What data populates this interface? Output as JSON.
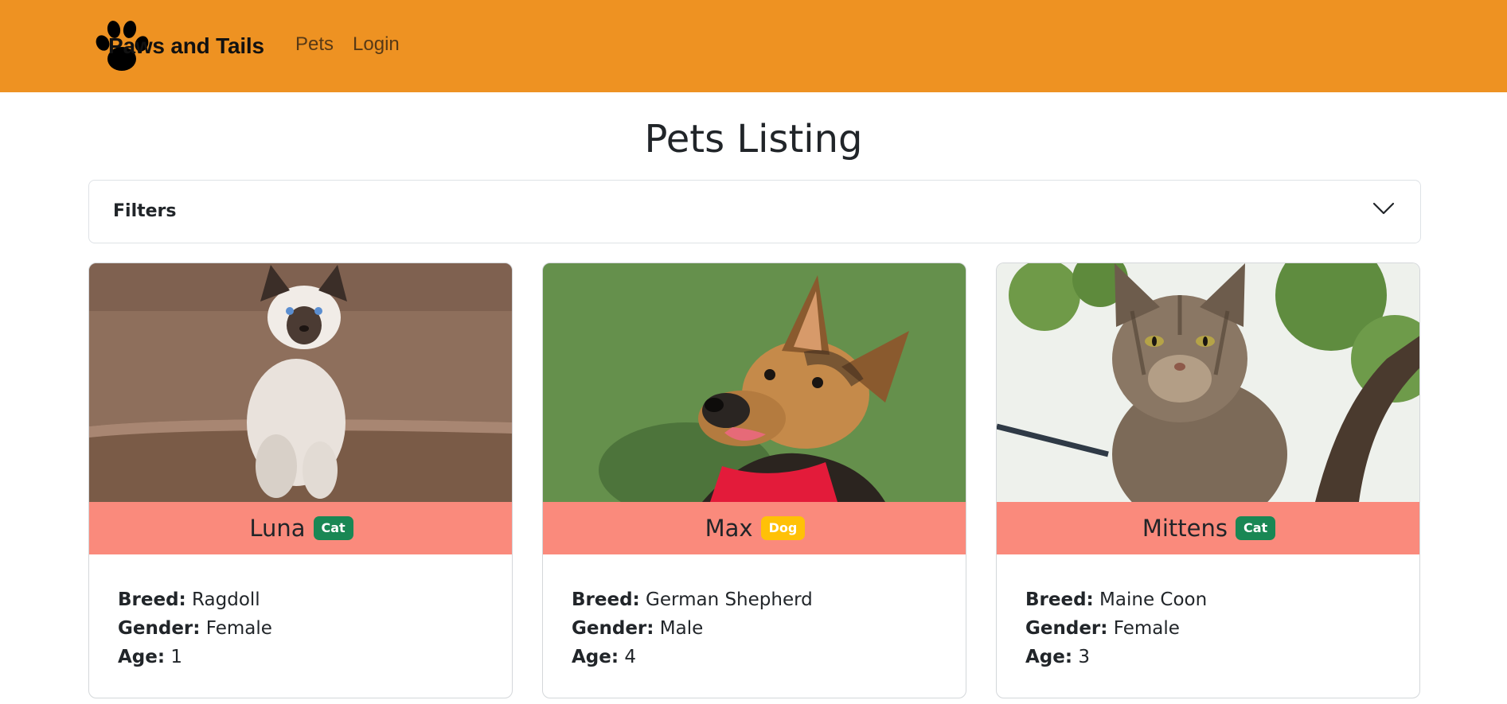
{
  "navbar": {
    "brand": "Paws and Tails",
    "links": [
      "Pets",
      "Login"
    ]
  },
  "page": {
    "title": "Pets Listing",
    "filters_label": "Filters"
  },
  "labels": {
    "breed": "Breed:",
    "gender": "Gender:",
    "age": "Age:"
  },
  "pets": [
    {
      "name": "Luna",
      "type": "Cat",
      "breed": "Ragdoll",
      "gender": "Female",
      "age": "1"
    },
    {
      "name": "Max",
      "type": "Dog",
      "breed": "German Shepherd",
      "gender": "Male",
      "age": "4"
    },
    {
      "name": "Mittens",
      "type": "Cat",
      "breed": "Maine Coon",
      "gender": "Female",
      "age": "3"
    }
  ],
  "colors": {
    "navbar": "#ee9222",
    "card_header": "#fa8a7c",
    "badge_cat": "#198754",
    "badge_dog": "#ffc107"
  }
}
